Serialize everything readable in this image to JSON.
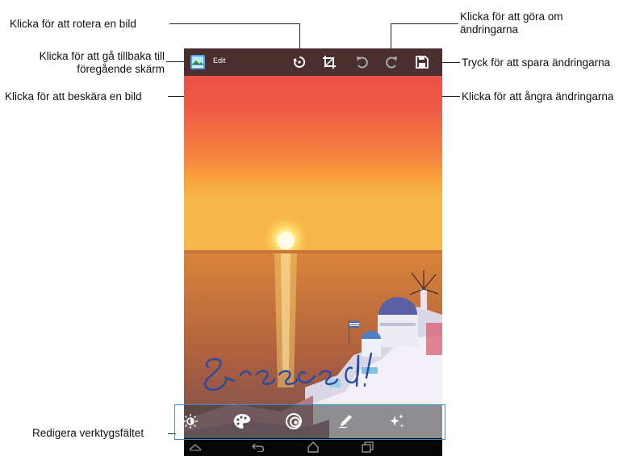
{
  "screen": {
    "edit_label": "Edit",
    "handwriting": "Greece!"
  },
  "callouts": {
    "rotate": "Klicka för att rotera en bild",
    "back_line1": "Klicka för att gå tillbaka till",
    "back_line2": "föregående skärm",
    "crop": "Klicka för att beskära en bild",
    "redo_line1": "Klicka för att göra om",
    "redo_line2": "ändringarna",
    "save": "Tryck för att spara ändringarna",
    "undo": "Klicka för att ångra ändringarna",
    "toolbar": "Redigera verktygsfältet"
  },
  "icons": {
    "app": "gallery-app-icon",
    "rotate": "rotate-icon",
    "crop": "crop-icon",
    "undo": "undo-icon",
    "redo": "redo-icon",
    "save": "save-icon",
    "brightness": "brightness-icon",
    "color": "palette-icon",
    "effects": "effects-icon",
    "draw": "pen-icon",
    "sparkle": "sparkle-icon",
    "home": "home-icon",
    "back": "back-icon",
    "recents": "recent-apps-icon",
    "collapse": "collapse-icon"
  },
  "colors": {
    "callout_line": "#222222",
    "toolbar_highlight": "#3a8ec8",
    "handwriting": "#2a4aa0"
  }
}
